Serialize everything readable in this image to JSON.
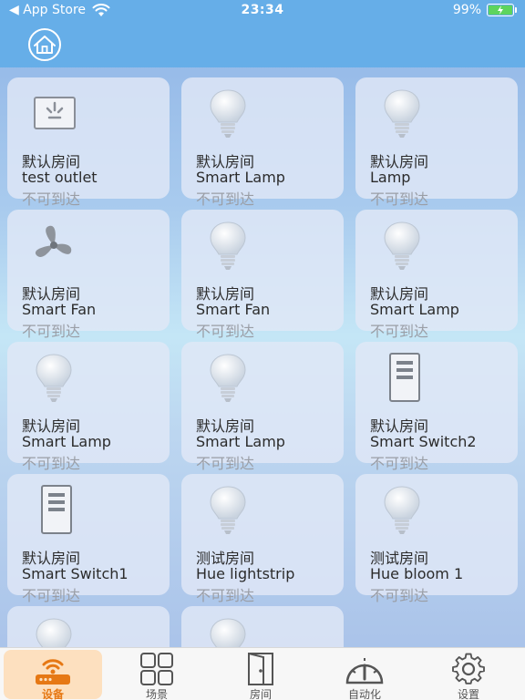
{
  "status_bar": {
    "back_label": "◀ App Store",
    "time": "23:34",
    "battery": "99%"
  },
  "nav": {
    "home_icon": "home-icon"
  },
  "devices": [
    {
      "room": "默认房间",
      "name": "test outlet",
      "status": "不可到达",
      "icon": "outlet-icon"
    },
    {
      "room": "默认房间",
      "name": "Smart Lamp",
      "status": "不可到达",
      "icon": "bulb-icon"
    },
    {
      "room": "默认房间",
      "name": "Lamp",
      "status": "不可到达",
      "icon": "bulb-icon"
    },
    {
      "room": "默认房间",
      "name": "Smart Fan",
      "status": "不可到达",
      "icon": "fan-icon"
    },
    {
      "room": "默认房间",
      "name": "Smart Fan",
      "status": "不可到达",
      "icon": "bulb-icon"
    },
    {
      "room": "默认房间",
      "name": "Smart Lamp",
      "status": "不可到达",
      "icon": "bulb-icon"
    },
    {
      "room": "默认房间",
      "name": "Smart Lamp",
      "status": "不可到达",
      "icon": "bulb-icon"
    },
    {
      "room": "默认房间",
      "name": "Smart Lamp",
      "status": "不可到达",
      "icon": "bulb-icon"
    },
    {
      "room": "默认房间",
      "name": "Smart Switch2",
      "status": "不可到达",
      "icon": "switch-icon"
    },
    {
      "room": "默认房间",
      "name": "Smart Switch1",
      "status": "不可到达",
      "icon": "switch-icon"
    },
    {
      "room": "测试房间",
      "name": "Hue lightstrip",
      "status": "不可到达",
      "icon": "bulb-icon"
    },
    {
      "room": "测试房间",
      "name": "Hue bloom 1",
      "status": "不可到达",
      "icon": "bulb-icon"
    },
    {
      "room": "",
      "name": "",
      "status": "",
      "icon": "bulb-icon"
    },
    {
      "room": "",
      "name": "",
      "status": "",
      "icon": "bulb-icon"
    }
  ],
  "tabs": [
    {
      "label": "设备",
      "icon": "router-icon",
      "active": true
    },
    {
      "label": "场景",
      "icon": "grid-icon",
      "active": false
    },
    {
      "label": "房间",
      "icon": "door-icon",
      "active": false
    },
    {
      "label": "自动化",
      "icon": "gauge-icon",
      "active": false
    },
    {
      "label": "设置",
      "icon": "gear-icon",
      "active": false
    }
  ],
  "colors": {
    "nav_blue": "#66aee8",
    "tab_active": "#e67814",
    "status_gray": "#9a9ea6"
  }
}
